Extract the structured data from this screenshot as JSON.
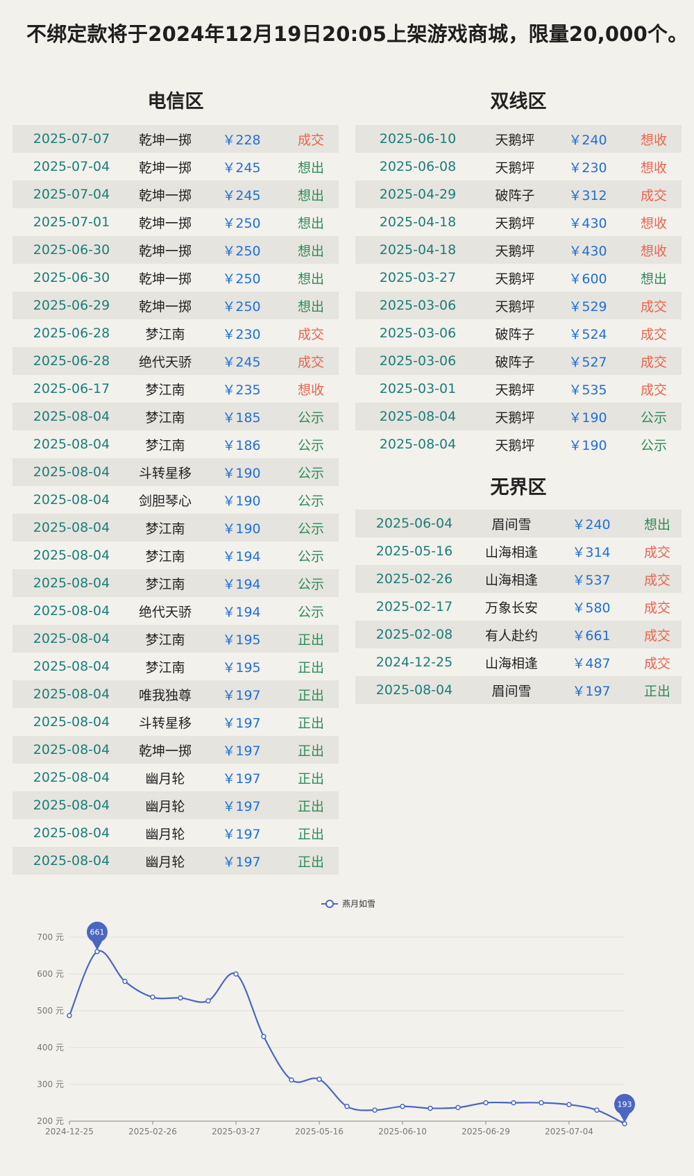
{
  "headline": "不绑定款将于2024年12月19日20:05上架游戏商城，限量20,000个。",
  "sections": {
    "dianxin": {
      "title": "电信区",
      "rows": [
        {
          "date": "2025-07-07",
          "server": "乾坤一掷",
          "price": "￥228",
          "status": "成交"
        },
        {
          "date": "2025-07-04",
          "server": "乾坤一掷",
          "price": "￥245",
          "status": "想出"
        },
        {
          "date": "2025-07-04",
          "server": "乾坤一掷",
          "price": "￥245",
          "status": "想出"
        },
        {
          "date": "2025-07-01",
          "server": "乾坤一掷",
          "price": "￥250",
          "status": "想出"
        },
        {
          "date": "2025-06-30",
          "server": "乾坤一掷",
          "price": "￥250",
          "status": "想出"
        },
        {
          "date": "2025-06-30",
          "server": "乾坤一掷",
          "price": "￥250",
          "status": "想出"
        },
        {
          "date": "2025-06-29",
          "server": "乾坤一掷",
          "price": "￥250",
          "status": "想出"
        },
        {
          "date": "2025-06-28",
          "server": "梦江南",
          "price": "￥230",
          "status": "成交"
        },
        {
          "date": "2025-06-28",
          "server": "绝代天骄",
          "price": "￥245",
          "status": "成交"
        },
        {
          "date": "2025-06-17",
          "server": "梦江南",
          "price": "￥235",
          "status": "想收"
        },
        {
          "date": "2025-08-04",
          "server": "梦江南",
          "price": "￥185",
          "status": "公示"
        },
        {
          "date": "2025-08-04",
          "server": "梦江南",
          "price": "￥186",
          "status": "公示"
        },
        {
          "date": "2025-08-04",
          "server": "斗转星移",
          "price": "￥190",
          "status": "公示"
        },
        {
          "date": "2025-08-04",
          "server": "剑胆琴心",
          "price": "￥190",
          "status": "公示"
        },
        {
          "date": "2025-08-04",
          "server": "梦江南",
          "price": "￥190",
          "status": "公示"
        },
        {
          "date": "2025-08-04",
          "server": "梦江南",
          "price": "￥194",
          "status": "公示"
        },
        {
          "date": "2025-08-04",
          "server": "梦江南",
          "price": "￥194",
          "status": "公示"
        },
        {
          "date": "2025-08-04",
          "server": "绝代天骄",
          "price": "￥194",
          "status": "公示"
        },
        {
          "date": "2025-08-04",
          "server": "梦江南",
          "price": "￥195",
          "status": "正出"
        },
        {
          "date": "2025-08-04",
          "server": "梦江南",
          "price": "￥195",
          "status": "正出"
        },
        {
          "date": "2025-08-04",
          "server": "唯我独尊",
          "price": "￥197",
          "status": "正出"
        },
        {
          "date": "2025-08-04",
          "server": "斗转星移",
          "price": "￥197",
          "status": "正出"
        },
        {
          "date": "2025-08-04",
          "server": "乾坤一掷",
          "price": "￥197",
          "status": "正出"
        },
        {
          "date": "2025-08-04",
          "server": "幽月轮",
          "price": "￥197",
          "status": "正出"
        },
        {
          "date": "2025-08-04",
          "server": "幽月轮",
          "price": "￥197",
          "status": "正出"
        },
        {
          "date": "2025-08-04",
          "server": "幽月轮",
          "price": "￥197",
          "status": "正出"
        },
        {
          "date": "2025-08-04",
          "server": "幽月轮",
          "price": "￥197",
          "status": "正出"
        }
      ]
    },
    "shuangxian": {
      "title": "双线区",
      "rows": [
        {
          "date": "2025-06-10",
          "server": "天鹅坪",
          "price": "￥240",
          "status": "想收"
        },
        {
          "date": "2025-06-08",
          "server": "天鹅坪",
          "price": "￥230",
          "status": "想收"
        },
        {
          "date": "2025-04-29",
          "server": "破阵子",
          "price": "￥312",
          "status": "成交"
        },
        {
          "date": "2025-04-18",
          "server": "天鹅坪",
          "price": "￥430",
          "status": "想收"
        },
        {
          "date": "2025-04-18",
          "server": "天鹅坪",
          "price": "￥430",
          "status": "想收"
        },
        {
          "date": "2025-03-27",
          "server": "天鹅坪",
          "price": "￥600",
          "status": "想出"
        },
        {
          "date": "2025-03-06",
          "server": "天鹅坪",
          "price": "￥529",
          "status": "成交"
        },
        {
          "date": "2025-03-06",
          "server": "破阵子",
          "price": "￥524",
          "status": "成交"
        },
        {
          "date": "2025-03-06",
          "server": "破阵子",
          "price": "￥527",
          "status": "成交"
        },
        {
          "date": "2025-03-01",
          "server": "天鹅坪",
          "price": "￥535",
          "status": "成交"
        },
        {
          "date": "2025-08-04",
          "server": "天鹅坪",
          "price": "￥190",
          "status": "公示"
        },
        {
          "date": "2025-08-04",
          "server": "天鹅坪",
          "price": "￥190",
          "status": "公示"
        }
      ]
    },
    "wujie": {
      "title": "无界区",
      "rows": [
        {
          "date": "2025-06-04",
          "server": "眉间雪",
          "price": "￥240",
          "status": "想出"
        },
        {
          "date": "2025-05-16",
          "server": "山海相逢",
          "price": "￥314",
          "status": "成交"
        },
        {
          "date": "2025-02-26",
          "server": "山海相逢",
          "price": "￥537",
          "status": "成交"
        },
        {
          "date": "2025-02-17",
          "server": "万象长安",
          "price": "￥580",
          "status": "成交"
        },
        {
          "date": "2025-02-08",
          "server": "有人赴约",
          "price": "￥661",
          "status": "成交"
        },
        {
          "date": "2024-12-25",
          "server": "山海相逢",
          "price": "￥487",
          "status": "成交"
        },
        {
          "date": "2025-08-04",
          "server": "眉间雪",
          "price": "￥197",
          "status": "正出"
        }
      ]
    }
  },
  "status_colors": {
    "成交": "#e8644f",
    "想收": "#e8644f",
    "想出": "#2e8b57",
    "公示": "#2e8b57",
    "正出": "#2e8b57"
  },
  "chart_data": {
    "type": "line",
    "legend": "燕月如雪",
    "legend_position": "top-center",
    "series": [
      {
        "name": "燕月如雪",
        "color": "#4a66c1",
        "values": [
          487,
          661,
          580,
          537,
          535,
          527,
          600,
          430,
          312,
          314,
          240,
          230,
          240,
          235,
          237,
          250,
          250,
          250,
          245,
          230,
          193
        ]
      }
    ],
    "x_tick_labels": [
      "2024-12-25",
      "2025-02-26",
      "2025-03-27",
      "2025-05-16",
      "2025-06-10",
      "2025-06-29",
      "2025-07-04"
    ],
    "y_ticks": [
      200,
      300,
      400,
      500,
      600,
      700
    ],
    "y_unit": "元",
    "ylim": [
      200,
      700
    ],
    "grid": true,
    "markers": [
      {
        "label": "661",
        "index": 1
      },
      {
        "label": "193",
        "index": 20
      }
    ]
  }
}
